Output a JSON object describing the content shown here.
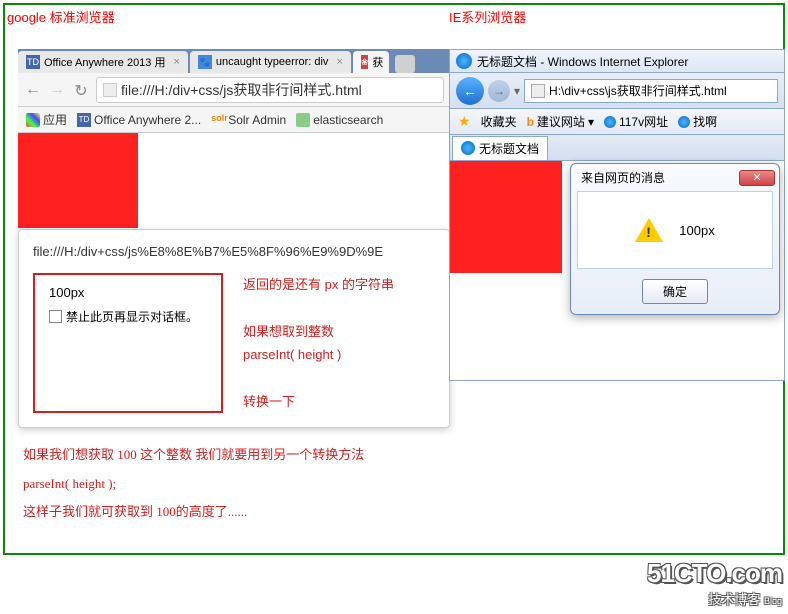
{
  "labels": {
    "google": "google 标准浏览器",
    "ie": "IE系列浏览器"
  },
  "chrome": {
    "tabs": [
      {
        "label": "Office Anywhere 2013 用"
      },
      {
        "label": "uncaught typeerror: div"
      },
      {
        "label": "获"
      }
    ],
    "url": "file:///H:/div+css/js获取非行间样式.html",
    "bookmarks": {
      "apps": "应用",
      "office": "Office Anywhere 2...",
      "solr": "Solr Admin",
      "elastic": "elasticsearch"
    },
    "alert": {
      "url": "file:///H:/div+css/js%E8%8E%B7%E5%8F%96%E9%9D%9E",
      "message": "100px",
      "checkbox_label": "禁止此页再显示对话框。",
      "note1": "返回的是还有 px 的字符串",
      "note2": "如果想取到整数",
      "note3": "parseInt( height )",
      "note4": "转换一下"
    }
  },
  "ie": {
    "title": "无标题文档 - Windows Internet Explorer",
    "url": "H:\\div+css\\js获取非行间样式.html",
    "favorites": "收藏夹",
    "suggest": "建议网站",
    "sites": "117v网址",
    "find": "找啊",
    "tab": "无标题文档",
    "dialog": {
      "title": "来自网页的消息",
      "message": "100px",
      "ok": "确定"
    }
  },
  "bottom": {
    "line1": "如果我们想获取 100 这个整数 我们就要用到另一个转换方法",
    "line2": "parseInt( height );",
    "line3": "这样子我们就可获取到 100的高度了......"
  },
  "watermark": {
    "main": "51CTO.com",
    "sub": "技术博客",
    "blog": "Blog"
  }
}
